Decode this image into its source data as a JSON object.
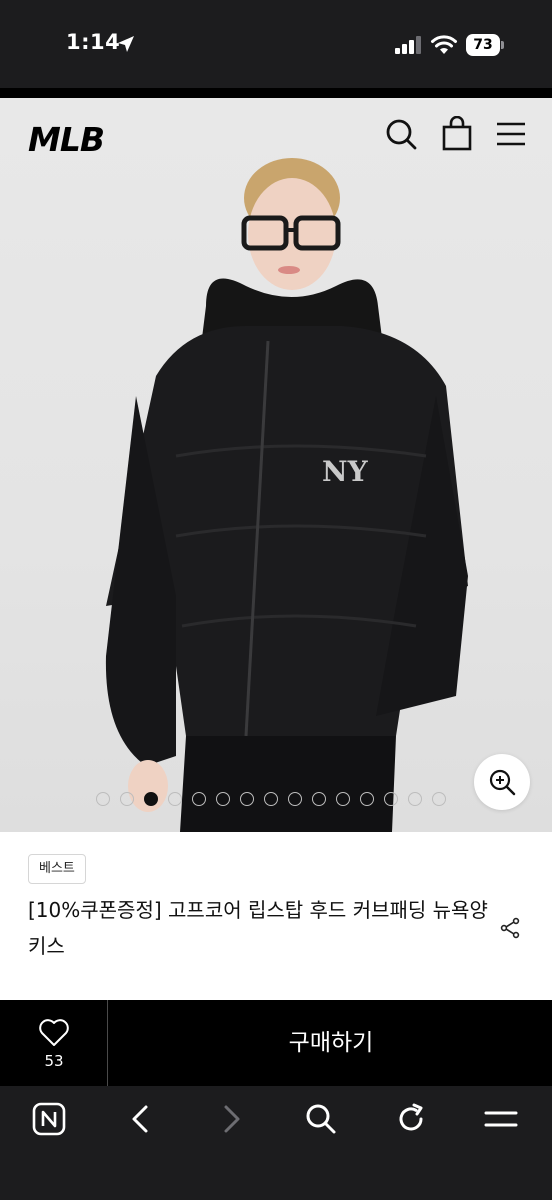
{
  "status_bar": {
    "time": "1:14",
    "battery": "73",
    "icons": [
      "location-arrow-icon",
      "cell-signal-icon",
      "wifi-icon",
      "battery-icon"
    ]
  },
  "header": {
    "logo": "MLB",
    "icons": [
      "search-icon",
      "shopping-bag-icon",
      "menu-icon"
    ]
  },
  "gallery": {
    "image_count": 15,
    "active_index": 2,
    "zoom_icon": "zoom-in-icon"
  },
  "product": {
    "badge": "베스트",
    "title": "[10%쿠폰증정] 고프코어 립스탑 후드 커브패딩 뉴욕양키스",
    "share_icon": "share-icon"
  },
  "purchase": {
    "like_count": "53",
    "buy_label": "구매하기"
  },
  "browser_toolbar": {
    "icons": [
      "naver-home-icon",
      "back-icon",
      "forward-icon",
      "search-icon",
      "reload-icon",
      "menu-icon"
    ]
  },
  "colors": {
    "system_bar": "#1c1c1e",
    "hero_bg": "#e6e6e6",
    "buy_bar": "#000000",
    "active_dot": "#111111"
  }
}
